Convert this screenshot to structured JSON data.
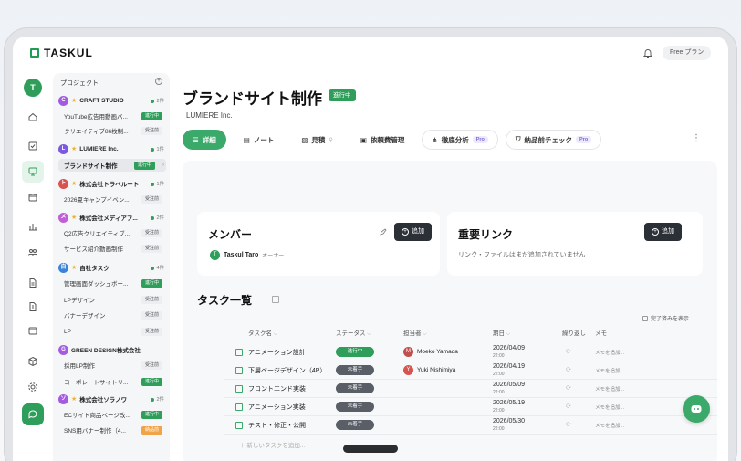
{
  "app": {
    "logo": "TASKUL",
    "plan_button": "Free プラン",
    "user_initial": "T"
  },
  "sidebar": {
    "header": "プロジェクト",
    "groups": [
      {
        "initial": "C",
        "color": "#a35be0",
        "name": "CRAFT STUDIO",
        "count": "2件",
        "items": [
          {
            "name": "YouTube広告用動画バ...",
            "status": "進行中"
          },
          {
            "name": "クリエイティブ86枚制...",
            "status": "受注前"
          }
        ]
      },
      {
        "initial": "L",
        "color": "#7b5ae0",
        "name": "LUMIERE Inc.",
        "count": "1件",
        "items": [
          {
            "name": "ブランドサイト制作",
            "status": "進行中"
          }
        ]
      },
      {
        "initial": "ト",
        "color": "#d9534f",
        "name": "株式会社トラベルート",
        "count": "1件",
        "items": [
          {
            "name": "2026夏キャンプイベン...",
            "status": "受注前"
          }
        ]
      },
      {
        "initial": "メ",
        "color": "#c25fd6",
        "name": "株式会社メディアフ...",
        "count": "2件",
        "items": [
          {
            "name": "Q2広告クリエイティブ...",
            "status": "受注前"
          },
          {
            "name": "サービス紹介動画制作",
            "status": "受注前"
          }
        ]
      },
      {
        "initial": "自",
        "color": "#3b82d9",
        "name": "自社タスク",
        "count": "4件",
        "items": [
          {
            "name": "管理画面ダッシュボー...",
            "status": "進行中"
          },
          {
            "name": "LPデザイン",
            "status": "受注前"
          },
          {
            "name": "バナーデザイン",
            "status": "受注前"
          },
          {
            "name": "LP",
            "status": "受注前"
          }
        ]
      },
      {
        "initial": "G",
        "color": "#a35be0",
        "name": "GREEN DESIGN株式会社",
        "count": "",
        "items": [
          {
            "name": "採用LP制作",
            "status": "受注前"
          },
          {
            "name": "コーポレートサイトリ...",
            "status": "進行中"
          }
        ]
      },
      {
        "initial": "ソ",
        "color": "#a35be0",
        "name": "株式会社ソラノワ",
        "count": "2件",
        "items": [
          {
            "name": "ECサイト商品ページ改...",
            "status": "進行中"
          },
          {
            "name": "SNS用バナー制作（4...",
            "status": "納品前"
          }
        ]
      }
    ]
  },
  "project": {
    "title": "ブランドサイト制作",
    "status": "進行中",
    "client": "LUMIERE Inc."
  },
  "tabs": {
    "detail": "詳細",
    "note": "ノート",
    "estimate": "見積",
    "expense": "依頼費管理",
    "analysis": "徹底分析",
    "precheck": "納品前チェック",
    "pro": "Pro"
  },
  "members": {
    "title": "メンバー",
    "add": "追加",
    "list": [
      {
        "initial": "T",
        "name": "Taskul Taro",
        "role": "オーナー"
      }
    ]
  },
  "links": {
    "title": "重要リンク",
    "add": "追加",
    "empty": "リンク・ファイルはまだ追加されていません"
  },
  "tasks": {
    "title": "タスク一覧",
    "show_done": "完了済みを表示",
    "columns": {
      "name": "タスク名",
      "status": "ステータス",
      "assignee": "担当者",
      "due": "期日",
      "repeat": "繰り返し",
      "memo": "メモ"
    },
    "rows": [
      {
        "name": "アニメーション設計",
        "status": "進行中",
        "kind": "prog",
        "assignee_initial": "M",
        "assignee_color": "#c0504d",
        "assignee": "Moeko Yamada",
        "date": "2026/04/09",
        "time": "22:00",
        "memo": "メモを追加..."
      },
      {
        "name": "下層ページデザイン（4P）",
        "status": "未着手",
        "kind": "todo",
        "assignee_initial": "Y",
        "assignee_color": "#d9534f",
        "assignee": "Yuki Nishimiya",
        "date": "2026/04/19",
        "time": "22:00",
        "memo": "メモを追加..."
      },
      {
        "name": "フロントエンド実装",
        "status": "未着手",
        "kind": "todo",
        "assignee_initial": "",
        "assignee_color": "",
        "assignee": "",
        "date": "2026/05/09",
        "time": "22:00",
        "memo": "メモを追加..."
      },
      {
        "name": "アニメーション実装",
        "status": "未着手",
        "kind": "todo",
        "assignee_initial": "",
        "assignee_color": "",
        "assignee": "",
        "date": "2026/05/19",
        "time": "22:00",
        "memo": "メモを追加..."
      },
      {
        "name": "テスト・修正・公開",
        "status": "未着手",
        "kind": "todo",
        "assignee_initial": "",
        "assignee_color": "",
        "assignee": "",
        "date": "2026/05/30",
        "time": "22:00",
        "memo": "メモを追加..."
      }
    ],
    "new_placeholder": "新しいタスクを追加..."
  }
}
